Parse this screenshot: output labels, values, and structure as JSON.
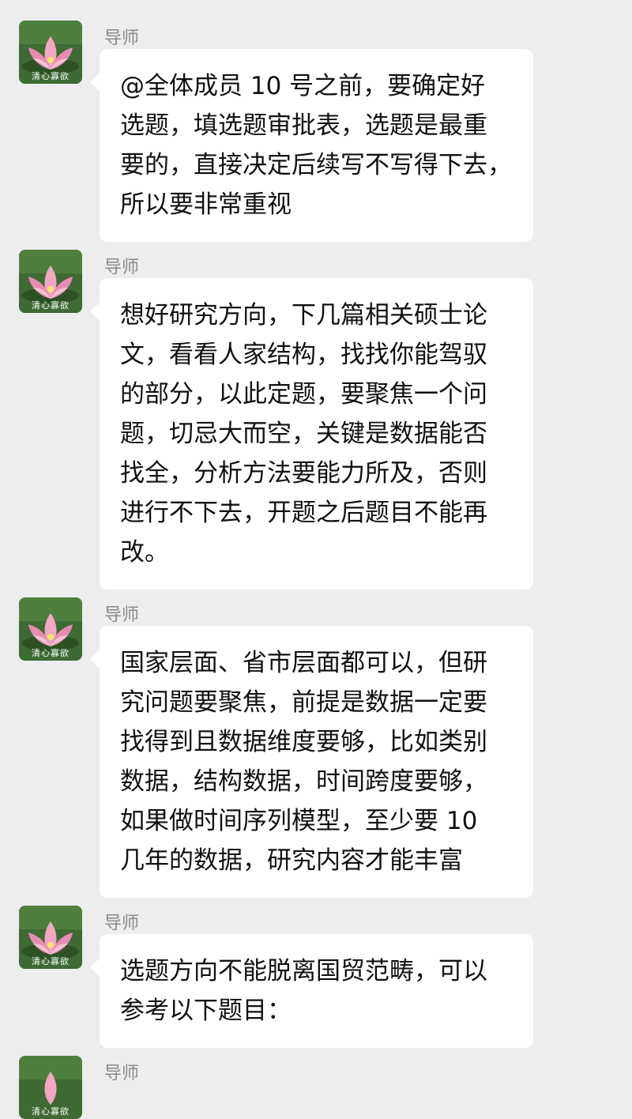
{
  "chat": {
    "messages": [
      {
        "sender": "导师",
        "avatar_caption": "清心寡欲",
        "lines": [
          "@全体成员 10 号之前，要确定好",
          "选题，填选题审批表，选题是最重",
          "要的，直接决定后续写不写得下去，",
          "所以要非常重视"
        ]
      },
      {
        "sender": "导师",
        "avatar_caption": "清心寡欲",
        "lines": [
          "想好研究方向，下几篇相关硕士论",
          "文，看看人家结构，找找你能驾驭",
          "的部分，以此定题，要聚焦一个问",
          "题，切忌大而空，关键是数据能否",
          "找全，分析方法要能力所及，否则",
          "进行不下去，开题之后题目不能再",
          "改。"
        ]
      },
      {
        "sender": "导师",
        "avatar_caption": "清心寡欲",
        "lines": [
          "国家层面、省市层面都可以，但研",
          "究问题要聚焦，前提是数据一定要",
          "找得到且数据维度要够，比如类别",
          "数据，结构数据，时间跨度要够，",
          "如果做时间序列模型，至少要 10",
          "几年的数据，研究内容才能丰富"
        ]
      },
      {
        "sender": "导师",
        "avatar_caption": "清心寡欲",
        "lines": [
          "选题方向不能脱离国贸范畴，可以",
          "参考以下题目："
        ]
      },
      {
        "sender": "导师",
        "avatar_caption": "清心寡欲",
        "lines": []
      }
    ]
  }
}
